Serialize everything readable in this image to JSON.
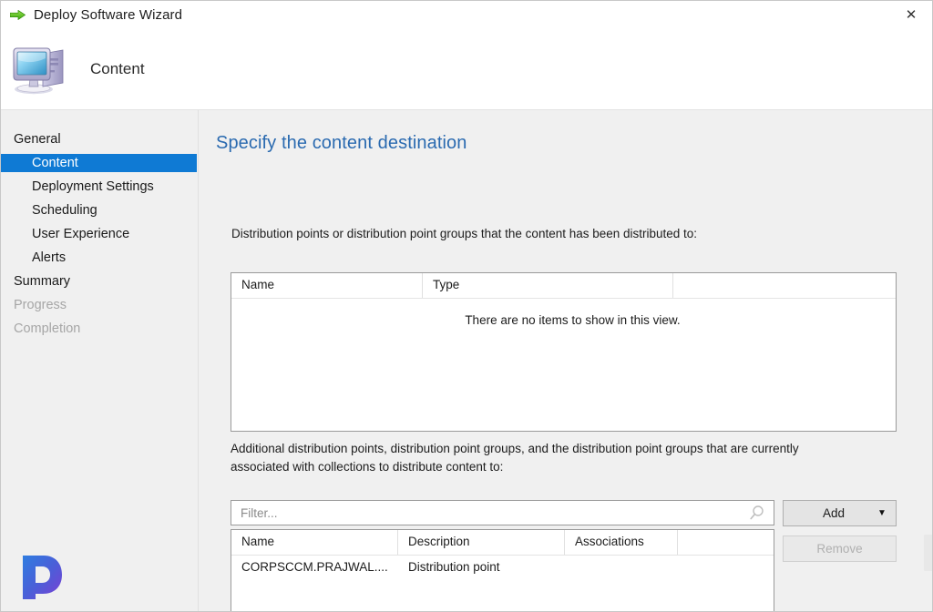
{
  "window": {
    "title": "Deploy Software Wizard",
    "title_icon": "green-arrow-icon",
    "close_label": "✕"
  },
  "header": {
    "title": "Content",
    "icon": "computer-icon"
  },
  "sidebar": {
    "items": [
      {
        "label": "General",
        "level": "top",
        "state": "normal"
      },
      {
        "label": "Content",
        "level": "sub",
        "state": "selected"
      },
      {
        "label": "Deployment Settings",
        "level": "sub",
        "state": "normal"
      },
      {
        "label": "Scheduling",
        "level": "sub",
        "state": "normal"
      },
      {
        "label": "User Experience",
        "level": "sub",
        "state": "normal"
      },
      {
        "label": "Alerts",
        "level": "sub",
        "state": "normal"
      },
      {
        "label": "Summary",
        "level": "top",
        "state": "normal"
      },
      {
        "label": "Progress",
        "level": "top",
        "state": "disabled"
      },
      {
        "label": "Completion",
        "level": "top",
        "state": "disabled"
      }
    ]
  },
  "main": {
    "page_title": "Specify the content destination",
    "distributed_label": "Distribution points or distribution point groups that the content has been distributed to:",
    "additional_label": "Additional distribution points, distribution point groups, and the distribution point groups that are currently associated with collections to distribute content to:",
    "distributed_list": {
      "columns": [
        "Name",
        "Type"
      ],
      "rows": [],
      "empty_message": "There are no items to show in this view."
    },
    "filter": {
      "value": "",
      "placeholder": "Filter...",
      "icon": "search-icon"
    },
    "additional_list": {
      "columns": [
        "Name",
        "Description",
        "Associations"
      ],
      "rows": [
        {
          "name": "CORPSCCM.PRAJWAL....",
          "description": "Distribution point",
          "associations": ""
        }
      ]
    },
    "buttons": {
      "add": "Add",
      "add_caret": "▼",
      "remove": "Remove"
    }
  },
  "branding": {
    "logo_letter": "P",
    "accent_start": "#3d6fe0",
    "accent_end": "#7b3fd4"
  },
  "colors": {
    "selection": "#0f7ad4",
    "page_title": "#2a6ab0",
    "window_bg": "#f0f0f0",
    "panel_bg": "#ffffff",
    "disabled_text": "#a6a6a6"
  }
}
